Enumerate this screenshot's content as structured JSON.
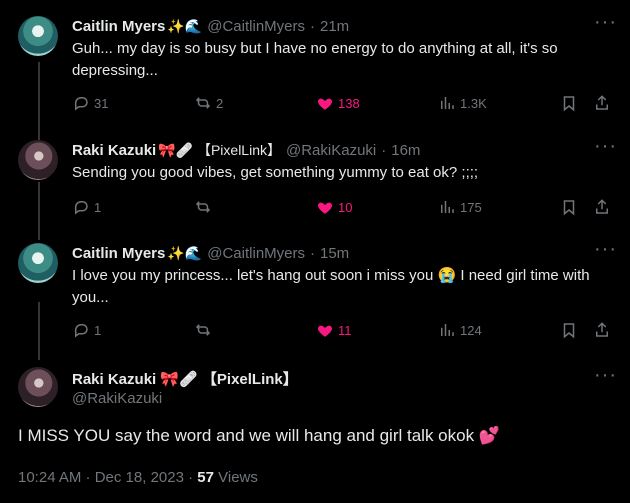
{
  "tweets": [
    {
      "name": "Caitlin Myers",
      "badges": "✨🌊",
      "handle": "@CaitlinMyers",
      "time": "21m",
      "text": "Guh... my day is so busy but I have no energy to do anything at all, it's so depressing...",
      "replies": "31",
      "reposts": "2",
      "likes": "138",
      "views": "1.3K"
    },
    {
      "name": "Raki Kazuki",
      "badges": "🎀🩹 【PixelLink】",
      "handle": "@RakiKazuki",
      "time": "16m",
      "text": "Sending you good vibes, get something yummy to eat ok? ;;;;",
      "replies": "1",
      "reposts": "",
      "likes": "10",
      "views": "175"
    },
    {
      "name": "Caitlin Myers",
      "badges": "✨🌊",
      "handle": "@CaitlinMyers",
      "time": "15m",
      "text": "I love you my princess... let's hang out soon i miss you 😭 I need girl time with you...",
      "replies": "1",
      "reposts": "",
      "likes": "11",
      "views": "124"
    }
  ],
  "main": {
    "name": "Raki Kazuki",
    "badges": "🎀🩹 【PixelLink】",
    "handle": "@RakiKazuki",
    "text": "I MISS YOU say the word and we will hang and girl talk okok 💕",
    "time": "10:24 AM · Dec 18, 2023 ·",
    "views_count": "57",
    "views_label": "Views"
  },
  "icons": [
    "reply-icon",
    "repost-icon",
    "like-icon",
    "views-icon",
    "bookmark-icon",
    "share-icon",
    "more-icon"
  ],
  "colors": {
    "background": "#000000",
    "text": "#e7e9ea",
    "muted": "#71767b",
    "like": "#f91880",
    "line": "#333639"
  }
}
